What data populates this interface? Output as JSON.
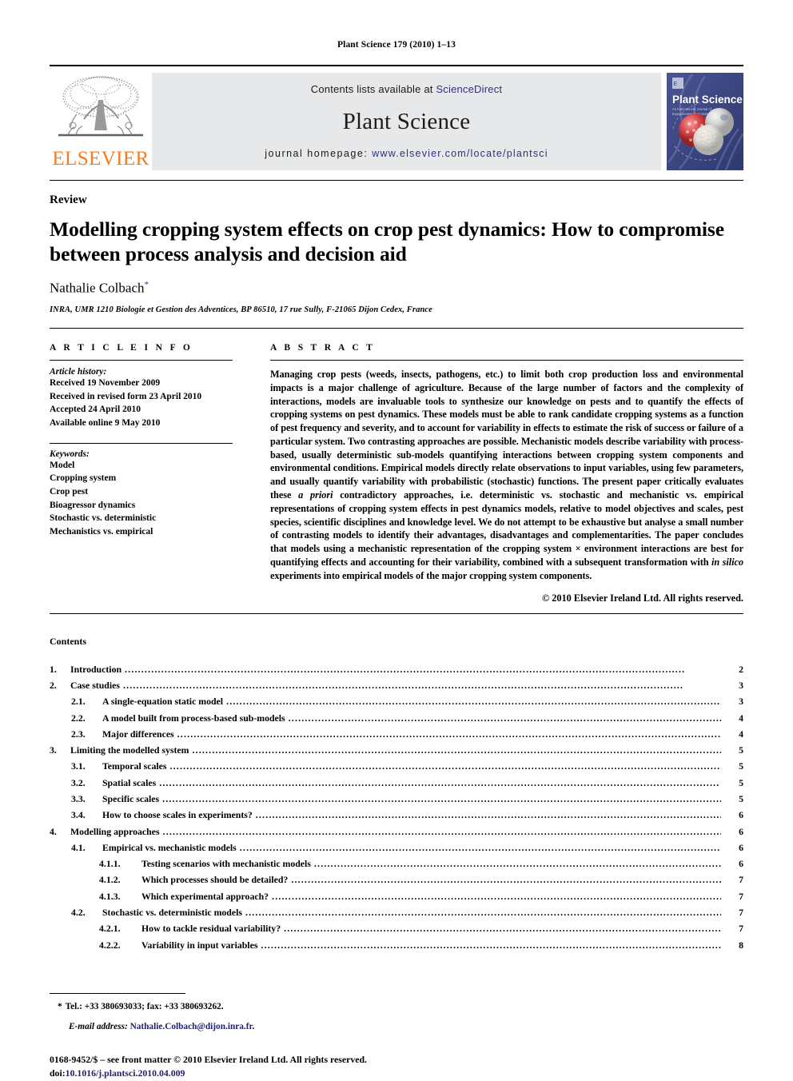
{
  "running_head": "Plant Science 179 (2010) 1–13",
  "journal_header": {
    "contents_prefix": "Contents lists available at ",
    "sciencedirect": "ScienceDirect",
    "journal_name": "Plant Science",
    "homepage_prefix": "journal homepage:",
    "homepage_url": "www.elsevier.com/locate/plantsci",
    "publisher_wordmark": "ELSEVIER",
    "publisher_logo_icon": "elsevier-tree-icon",
    "cover_title": "Plant Science",
    "cover_subtitle": "An International Journal of Experimental Plant Biology",
    "band_bg": "#e7e8ea",
    "link_color": "#2c2f8f",
    "wordmark_color": "#F57C1F"
  },
  "article": {
    "type": "Review",
    "title": "Modelling cropping system effects on crop pest dynamics: How to compromise between process analysis and decision aid",
    "author": "Nathalie Colbach",
    "author_marker": "*",
    "affiliation": "INRA, UMR 1210 Biologie et Gestion des Adventices, BP 86510, 17 rue Sully, F-21065 Dijon Cedex, France"
  },
  "article_info": {
    "heading": "A R T I C L E  I N F O",
    "history_title": "Article history:",
    "history": [
      "Received 19 November 2009",
      "Received in revised form 23 April 2010",
      "Accepted 24 April 2010",
      "Available online 9 May 2010"
    ],
    "keywords_title": "Keywords:",
    "keywords": [
      "Model",
      "Cropping system",
      "Crop pest",
      "Bioagressor dynamics",
      "Stochastic vs. deterministic",
      "Mechanistics vs. empirical"
    ]
  },
  "abstract": {
    "heading": "A B S T R A C T",
    "paragraph_1": "Managing crop pests (weeds, insects, pathogens, etc.) to limit both crop production loss and environmental impacts is a major challenge of agriculture. Because of the large number of factors and the complexity of interactions, models are invaluable tools to synthesize our knowledge on pests and to quantify the effects of cropping systems on pest dynamics. These models must be able to rank candidate cropping systems as a function of pest frequency and severity, and to account for variability in effects to estimate the risk of success or failure of a particular system. Two contrasting approaches are possible. Mechanistic models describe variability with process-based, usually deterministic sub-models quantifying interactions between cropping system components and environmental conditions. Empirical models directly relate observations to input variables, using few parameters, and usually quantify variability with probabilistic (stochastic) functions. The present paper critically evaluates these ",
    "italic_1": "a priori",
    "paragraph_2": " contradictory approaches, i.e. deterministic vs. stochastic and mechanistic vs. empirical representations of cropping system effects in pest dynamics models, relative to model objectives and scales, pest species, scientific disciplines and knowledge level. We do not attempt to be exhaustive but analyse a small number of contrasting models to identify their advantages, disadvantages and complementarities. The paper concludes that models using a mechanistic representation of the cropping system × environment interactions are best for quantifying effects and accounting for their variability, combined with a subsequent transformation with ",
    "italic_2": "in silico",
    "paragraph_3": " experiments into empirical models of the major cropping system components.",
    "copyright": "© 2010 Elsevier Ireland Ltd. All rights reserved."
  },
  "contents": {
    "heading": "Contents",
    "entries": [
      {
        "num": "1.",
        "label": "Introduction",
        "page": "2",
        "level": 1
      },
      {
        "num": "2.",
        "label": "Case studies",
        "page": "3",
        "level": 1
      },
      {
        "num": "2.1.",
        "label": "A single-equation static model",
        "page": "3",
        "level": 2
      },
      {
        "num": "2.2.",
        "label": "A model built from process-based sub-models",
        "page": "4",
        "level": 2
      },
      {
        "num": "2.3.",
        "label": "Major differences",
        "page": "4",
        "level": 2
      },
      {
        "num": "3.",
        "label": "Limiting the modelled system",
        "page": "5",
        "level": 1
      },
      {
        "num": "3.1.",
        "label": "Temporal scales",
        "page": "5",
        "level": 2
      },
      {
        "num": "3.2.",
        "label": "Spatial scales",
        "page": "5",
        "level": 2
      },
      {
        "num": "3.3.",
        "label": "Specific scales",
        "page": "5",
        "level": 2
      },
      {
        "num": "3.4.",
        "label": "How to choose scales in experiments?",
        "page": "6",
        "level": 2
      },
      {
        "num": "4.",
        "label": "Modelling approaches",
        "page": "6",
        "level": 1
      },
      {
        "num": "4.1.",
        "label": "Empirical vs. mechanistic models",
        "page": "6",
        "level": 2
      },
      {
        "num": "4.1.1.",
        "label": "Testing scenarios with mechanistic models",
        "page": "6",
        "level": 3
      },
      {
        "num": "4.1.2.",
        "label": "Which processes should be detailed?",
        "page": "7",
        "level": 3
      },
      {
        "num": "4.1.3.",
        "label": "Which experimental approach?",
        "page": "7",
        "level": 3
      },
      {
        "num": "4.2.",
        "label": "Stochastic vs. deterministic models",
        "page": "7",
        "level": 2
      },
      {
        "num": "4.2.1.",
        "label": "How to tackle residual variability?",
        "page": "7",
        "level": 3
      },
      {
        "num": "4.2.2.",
        "label": "Variability in input variables",
        "page": "8",
        "level": 3
      }
    ]
  },
  "footnotes": {
    "corresponding_marker": "*",
    "tel_fax": "Tel.: +33 380693033; fax: +33 380693262.",
    "email_label": "E-mail address:",
    "email": "Nathalie.Colbach@dijon.inra.fr",
    "email_trailing": ".",
    "issn_line": "0168-9452/$ – see front matter © 2010 Elsevier Ireland Ltd. All rights reserved.",
    "doi_label": "doi:",
    "doi": "10.1016/j.plantsci.2010.04.009",
    "link_color": "#21216e"
  }
}
